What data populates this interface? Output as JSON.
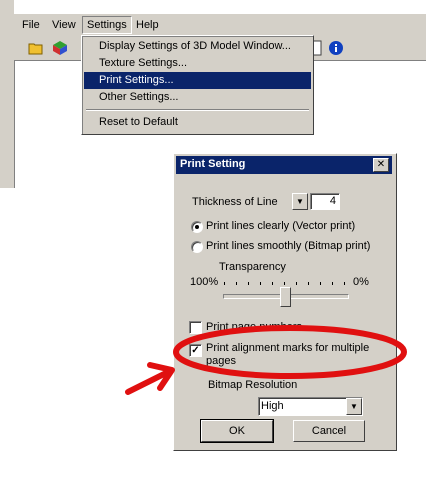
{
  "menubar": {
    "items": [
      {
        "label": "File"
      },
      {
        "label": "View"
      },
      {
        "label": "Settings"
      },
      {
        "label": "Help"
      }
    ]
  },
  "settings_menu": {
    "items": [
      {
        "label": "Display Settings of 3D Model Window..."
      },
      {
        "label": "Texture Settings..."
      },
      {
        "label": "Print Settings..."
      },
      {
        "label": "Other Settings..."
      },
      {
        "label": "Reset to Default"
      }
    ],
    "highlighted": "Print Settings..."
  },
  "dialog": {
    "title": "Print Setting",
    "close_glyph": "✕",
    "thickness": {
      "label": "Thickness of Line",
      "value": "4"
    },
    "radio_vector": {
      "label": "Print lines clearly (Vector print)",
      "checked": true
    },
    "radio_bitmap": {
      "label": "Print lines smoothly (Bitmap print)",
      "checked": false
    },
    "transparency": {
      "label": "Transparency",
      "min_label": "100%",
      "max_label": "0%",
      "value_fraction": 0.5
    },
    "checkbox_page": {
      "label": "Print page numbers",
      "checked": false
    },
    "checkbox_alignment": {
      "label_line1": "Print alignment marks for multiple",
      "label_line2": "pages",
      "checked": true
    },
    "resolution": {
      "label": "Bitmap Resolution",
      "value": "High"
    },
    "ok_label": "OK",
    "cancel_label": "Cancel"
  },
  "annotation": {
    "color": "#e01010"
  }
}
